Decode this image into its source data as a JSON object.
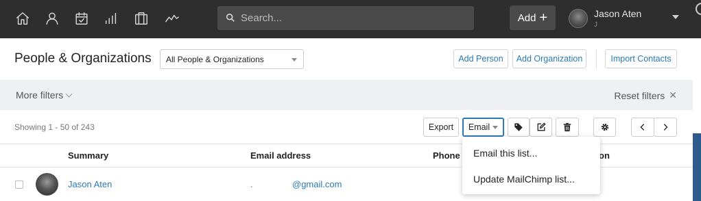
{
  "nav": {
    "icons": [
      "home-icon",
      "person-icon",
      "calendar-icon",
      "signal-bars-icon",
      "briefcase-icon",
      "trend-icon"
    ],
    "search_placeholder": "Search...",
    "add_label": "Add",
    "user_name": "Jason Aten",
    "user_sub": "J"
  },
  "header": {
    "title": "People & Organizations",
    "filter_select": "All People & Organizations",
    "add_person": "Add Person",
    "add_organization": "Add Organization",
    "import_contacts": "Import Contacts"
  },
  "filters": {
    "more_filters": "More filters",
    "reset_filters": "Reset filters"
  },
  "toolbar": {
    "showing": "Showing 1 - 50 of 243",
    "export": "Export",
    "email": "Email"
  },
  "table": {
    "columns": [
      "Summary",
      "Email address",
      "Phone",
      "on"
    ],
    "rows": [
      {
        "name": "Jason Aten",
        "email_prefix": ".",
        "email_domain": "@gmail.com"
      }
    ]
  },
  "email_menu": {
    "items": [
      "Email this list...",
      "Update MailChimp list..."
    ]
  },
  "colors": {
    "topbar": "#2e2e2e",
    "link": "#2a7ab8",
    "filterbar": "#eef0f4"
  }
}
